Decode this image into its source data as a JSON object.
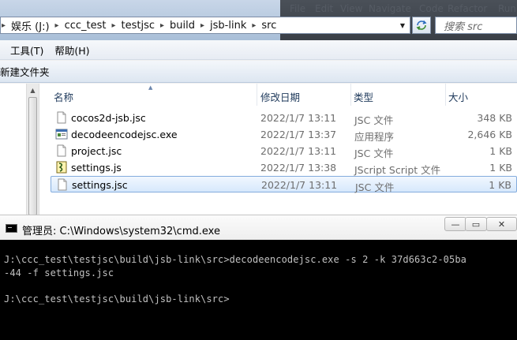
{
  "explorer": {
    "breadcrumb": [
      "娱乐 (J:)",
      "ccc_test",
      "testjsc",
      "build",
      "jsb-link",
      "src"
    ],
    "search_placeholder": "搜索 src",
    "background_menu": [
      "File",
      "Edit",
      "View",
      "Navigate",
      "Code",
      "Refactor",
      "Run"
    ],
    "menu": {
      "tools": "工具(T)",
      "help": "帮助(H)"
    },
    "toolbar": {
      "new_folder": "新建文件夹"
    },
    "columns": {
      "name": "名称",
      "date": "修改日期",
      "type": "类型",
      "size": "大小"
    },
    "files": [
      {
        "name": "cocos2d-jsb.jsc",
        "date": "2022/1/7 13:11",
        "type": "JSC 文件",
        "size": "348 KB",
        "icon": "generic-file-icon",
        "selected": false
      },
      {
        "name": "decodeencodejsc.exe",
        "date": "2022/1/7 13:37",
        "type": "应用程序",
        "size": "2,646 KB",
        "icon": "application-icon",
        "selected": false
      },
      {
        "name": "project.jsc",
        "date": "2022/1/7 13:11",
        "type": "JSC 文件",
        "size": "1 KB",
        "icon": "generic-file-icon",
        "selected": false
      },
      {
        "name": "settings.js",
        "date": "2022/1/7 13:38",
        "type": "JScript Script 文件",
        "size": "1 KB",
        "icon": "jscript-icon",
        "selected": false
      },
      {
        "name": "settings.jsc",
        "date": "2022/1/7 13:11",
        "type": "JSC 文件",
        "size": "1 KB",
        "icon": "generic-file-icon",
        "selected": true
      }
    ]
  },
  "cmd": {
    "title": "管理员: C:\\Windows\\system32\\cmd.exe",
    "lines": [
      "J:\\ccc_test\\testjsc\\build\\jsb-link\\src>decodeencodejsc.exe -s 2 -k 37d663c2-05ba",
      "-44 -f settings.jsc",
      "",
      "J:\\ccc_test\\testjsc\\build\\jsb-link\\src>"
    ]
  }
}
